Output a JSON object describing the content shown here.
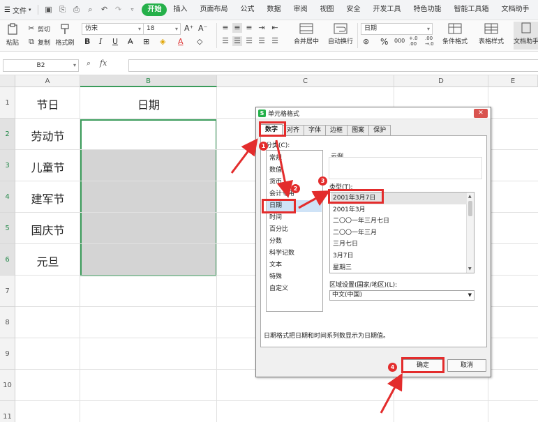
{
  "menubar": {
    "file_label": "文件",
    "tabs": [
      {
        "label": "开始",
        "active": true
      },
      {
        "label": "插入"
      },
      {
        "label": "页面布局"
      },
      {
        "label": "公式"
      },
      {
        "label": "数据"
      },
      {
        "label": "审阅"
      },
      {
        "label": "视图"
      },
      {
        "label": "安全"
      },
      {
        "label": "开发工具"
      },
      {
        "label": "特色功能"
      },
      {
        "label": "智能工具箱"
      },
      {
        "label": "文档助手"
      }
    ]
  },
  "ribbon": {
    "paste": "粘贴",
    "cut": "剪切",
    "copy": "复制",
    "format_painter": "格式刷",
    "font_name": "仿宋",
    "font_size": "18",
    "bold": "B",
    "italic": "I",
    "underline": "U",
    "number_format": "日期",
    "merge_center": "合并居中",
    "wrap_text": "自动换行",
    "conditional_format": "条件格式",
    "table_style": "表格样式",
    "doc_helper": "文档助手",
    "percent": "%",
    "thousands": "000",
    "inc_decimal": "+.0 .00",
    "dec_decimal": ".00 →.0",
    "font_up": "A⁺",
    "font_down": "A⁻"
  },
  "formula_bar": {
    "name_box": "B2",
    "fx_label": "fx",
    "value": ""
  },
  "sheet": {
    "columns": [
      "A",
      "B",
      "C",
      "D",
      "E"
    ],
    "rows": [
      "1",
      "2",
      "3",
      "4",
      "5",
      "6",
      "7",
      "8",
      "9",
      "10",
      "11"
    ],
    "header_a": "节日",
    "header_b": "日期",
    "holidays": [
      "劳动节",
      "儿童节",
      "建军节",
      "国庆节",
      "元旦"
    ]
  },
  "dialog": {
    "title": "单元格格式",
    "tabs": [
      "数字",
      "对齐",
      "字体",
      "边框",
      "图案",
      "保护"
    ],
    "category_label": "分类(C):",
    "categories": [
      "常规",
      "数值",
      "货币",
      "会计专用",
      "日期",
      "时间",
      "百分比",
      "分数",
      "科学记数",
      "文本",
      "特殊",
      "自定义"
    ],
    "selected_category": "日期",
    "sample_label": "示例",
    "type_label": "类型(T):",
    "types": [
      "2001年3月7日",
      "2001年3月",
      "二〇〇一年三月七日",
      "二〇〇一年三月",
      "三月七日",
      "3月7日",
      "星期三"
    ],
    "selected_type": "2001年3月7日",
    "locale_label": "区域设置(国家/地区)(L):",
    "locale_value": "中文(中国)",
    "description": "日期格式把日期和时间系列数显示为日期值。",
    "ok": "确定",
    "cancel": "取消"
  },
  "annotations": {
    "step_badges": [
      "1",
      "2",
      "3",
      "4"
    ],
    "color": "#e32c2c"
  },
  "colors": {
    "accent_green": "#25b04a",
    "selection_border": "#3a9b5a",
    "annotation_red": "#e32c2c"
  }
}
